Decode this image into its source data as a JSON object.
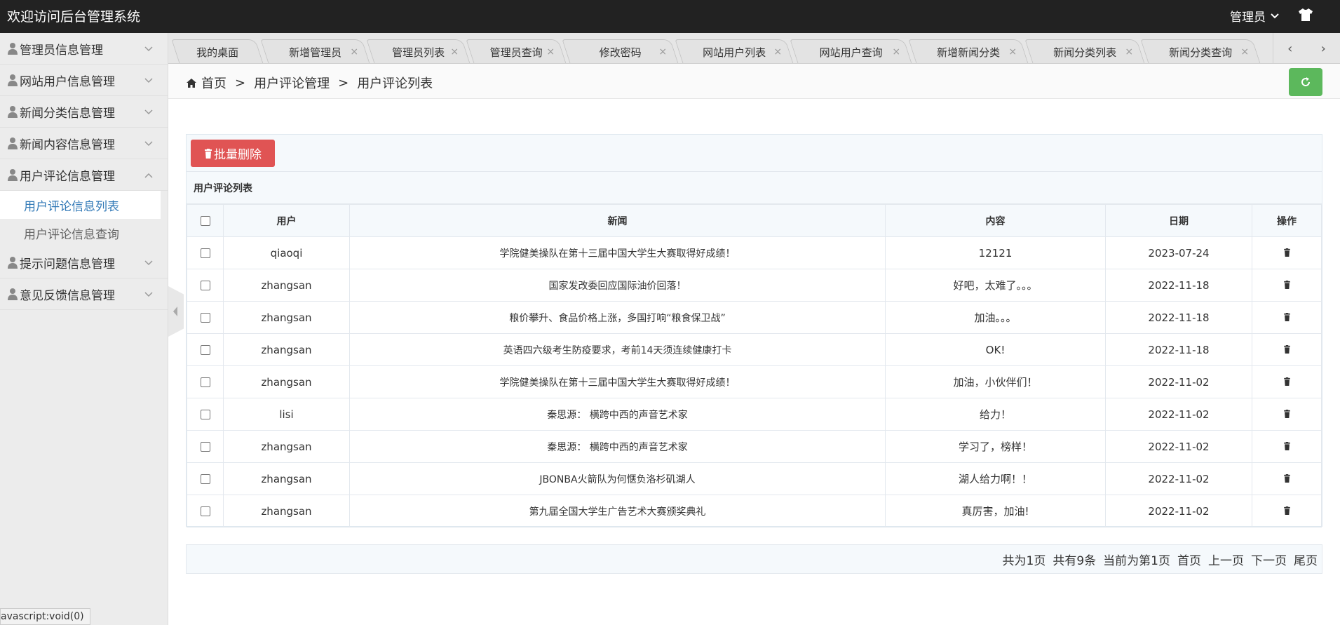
{
  "header": {
    "title": "欢迎访问后台管理系统",
    "user_label": "管理员"
  },
  "sidebar": {
    "items": [
      {
        "label": "管理员信息管理"
      },
      {
        "label": "网站用户信息管理"
      },
      {
        "label": "新闻分类信息管理"
      },
      {
        "label": "新闻内容信息管理"
      },
      {
        "label": "用户评论信息管理",
        "expanded": true
      }
    ],
    "subitems": [
      {
        "label": "用户评论信息列表",
        "active": true
      },
      {
        "label": "用户评论信息查询"
      }
    ],
    "items_after": [
      {
        "label": "提示问题信息管理"
      },
      {
        "label": "意见反馈信息管理"
      }
    ]
  },
  "tabs": [
    {
      "label": "我的桌面",
      "closable": false
    },
    {
      "label": "新增管理员",
      "closable": true
    },
    {
      "label": "管理员列表",
      "closable": true
    },
    {
      "label": "管理员查询",
      "closable": true
    },
    {
      "label": "修改密码",
      "closable": true
    },
    {
      "label": "网站用户列表",
      "closable": true
    },
    {
      "label": "网站用户查询",
      "closable": true
    },
    {
      "label": "新增新闻分类",
      "closable": true
    },
    {
      "label": "新闻分类列表",
      "closable": true
    },
    {
      "label": "新闻分类查询",
      "closable": true
    }
  ],
  "breadcrumb": {
    "home": "首页",
    "separator": ">",
    "level1": "用户评论管理",
    "level2": "用户评论列表"
  },
  "toolbar": {
    "batch_delete_label": "批量删除"
  },
  "panel_title": "用户评论列表",
  "table": {
    "headers": [
      "用户",
      "新闻",
      "内容",
      "日期",
      "操作"
    ],
    "rows": [
      {
        "user": "qiaoqi",
        "news": "学院健美操队在第十三届中国大学生大赛取得好成绩！",
        "content": "12121",
        "date": "2023-07-24"
      },
      {
        "user": "zhangsan",
        "news": "国家发改委回应国际油价回落！",
        "content": "好吧，太难了。。。",
        "date": "2022-11-18"
      },
      {
        "user": "zhangsan",
        "news": "粮价攀升、食品价格上涨，多国打响“粮食保卫战”",
        "content": "加油。。。",
        "date": "2022-11-18"
      },
      {
        "user": "zhangsan",
        "news": "英语四六级考生防疫要求，考前14天须连续健康打卡",
        "content": "OK!",
        "date": "2022-11-18"
      },
      {
        "user": "zhangsan",
        "news": "学院健美操队在第十三届中国大学生大赛取得好成绩！",
        "content": "加油，小伙伴们！",
        "date": "2022-11-02"
      },
      {
        "user": "lisi",
        "news": "秦思源： 横跨中西的声音艺术家",
        "content": "给力！",
        "date": "2022-11-02"
      },
      {
        "user": "zhangsan",
        "news": "秦思源： 横跨中西的声音艺术家",
        "content": "学习了，榜样！",
        "date": "2022-11-02"
      },
      {
        "user": "zhangsan",
        "news": "JBONBA火箭队为何惬负洛杉矶湖人",
        "content": "湖人给力啊！！",
        "date": "2022-11-02"
      },
      {
        "user": "zhangsan",
        "news": "第九届全国大学生广告艺术大赛颁奖典礼",
        "content": "真厉害，加油!",
        "date": "2022-11-02"
      }
    ]
  },
  "pager": {
    "total_pages": "共为1页",
    "total_items": "共有9条",
    "current": "当前为第1页",
    "first": "首页",
    "prev": "上一页",
    "next": "下一页",
    "last": "尾页"
  },
  "statusbar": "avascript:void(0)",
  "colors": {
    "header_bg": "#222222",
    "danger": "#e05454",
    "success": "#5cb85c",
    "link": "#337ab7"
  },
  "icons": {
    "user": "person-icon",
    "chevron": "chevron-down-icon",
    "shirt": "shirt-icon",
    "home": "home-icon",
    "refresh": "refresh-icon",
    "trash": "trash-icon"
  }
}
